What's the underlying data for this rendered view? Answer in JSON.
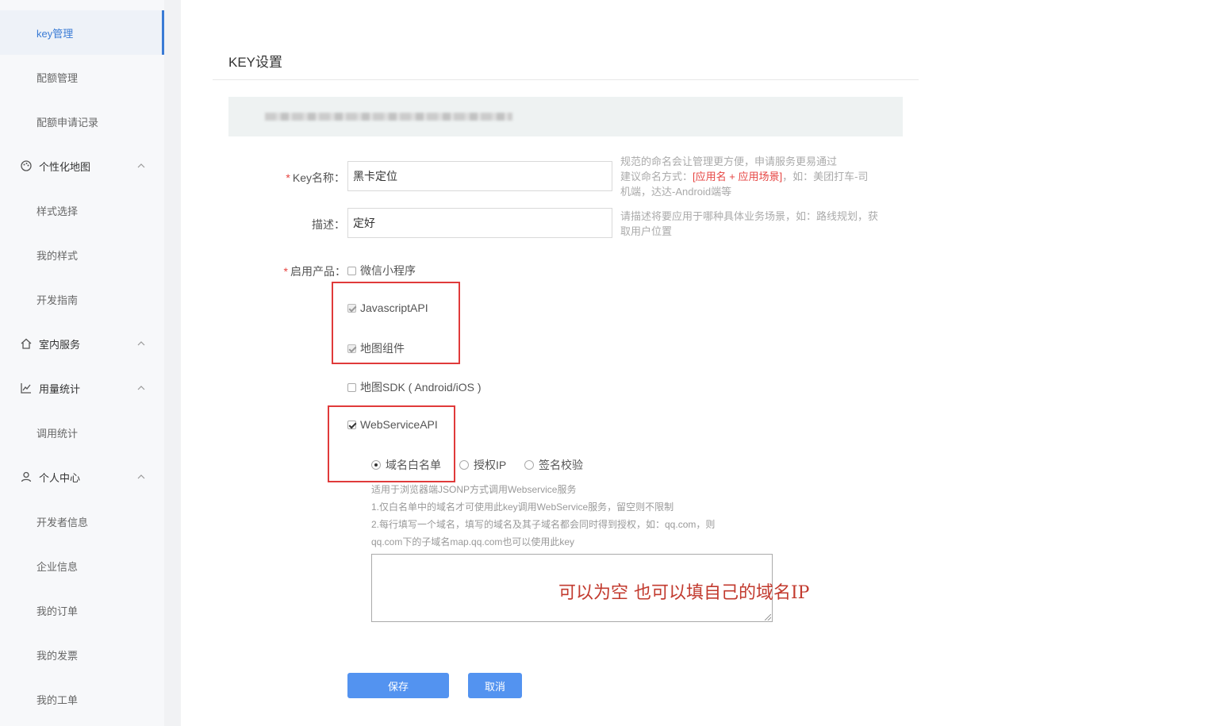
{
  "sidebar": {
    "items": [
      {
        "label": "key管理",
        "active": true
      },
      {
        "label": "配额管理"
      },
      {
        "label": "配额申请记录"
      },
      {
        "label": "个性化地图",
        "icon": "palette-icon",
        "group": true
      },
      {
        "label": "样式选择"
      },
      {
        "label": "我的样式"
      },
      {
        "label": "开发指南"
      },
      {
        "label": "室内服务",
        "icon": "home-icon",
        "group": true
      },
      {
        "label": "用量统计",
        "icon": "line-chart-icon",
        "group": true
      },
      {
        "label": "调用统计"
      },
      {
        "label": "个人中心",
        "icon": "user-icon",
        "group": true
      },
      {
        "label": "开发者信息"
      },
      {
        "label": "企业信息"
      },
      {
        "label": "我的订单"
      },
      {
        "label": "我的发票"
      },
      {
        "label": "我的工单"
      }
    ],
    "accent_color": "#3a7bd5"
  },
  "main": {
    "page_title": "KEY设置",
    "key_name": {
      "required_mark": "*",
      "label": "Key名称：",
      "value": "黑卡定位",
      "hint_line1": "规范的命名会让管理更方便，申请服务更易通过",
      "hint_line2_prefix": "建议命名方式：",
      "hint_line2_emphasis": "[应用名 + 应用场景]",
      "hint_line2_suffix": "，如：美团打车-司",
      "hint_line3": "机端，达达-Android端等"
    },
    "description": {
      "label": "描述：",
      "value": "定好",
      "hint_line1": "请描述将要应用于哪种具体业务场景，如：路线规划，获",
      "hint_line2": "取用户位置"
    },
    "products": {
      "required_mark": "*",
      "label": "启用产品：",
      "options": [
        {
          "label": "微信小程序",
          "checked": false,
          "disabled": false
        },
        {
          "label": "JavascriptAPI",
          "checked": true,
          "disabled": true
        },
        {
          "label": "地图组件",
          "checked": true,
          "disabled": true
        },
        {
          "label": "地图SDK ( Android/iOS )",
          "checked": false,
          "disabled": false
        },
        {
          "label": "WebServiceAPI",
          "checked": true,
          "disabled": false
        }
      ]
    },
    "webservice": {
      "auth_modes": [
        {
          "label": "域名白名单",
          "selected": true
        },
        {
          "label": "授权IP",
          "selected": false
        },
        {
          "label": "签名校验",
          "selected": false
        }
      ],
      "desc_lines": [
        "适用于浏览器端JSONP方式调用Webservice服务",
        "1.仅白名单中的域名才可使用此key调用WebService服务，留空则不限制",
        "2.每行填写一个域名，填写的域名及其子域名都会同时得到授权，如：qq.com，则",
        "qq.com下的子域名map.qq.com也可以使用此key"
      ],
      "whitelist_value": ""
    },
    "annotation": "可以为空  也可以填自己的域名IP",
    "buttons": {
      "save": "保存",
      "cancel": "取消"
    },
    "colors": {
      "primary_button": "#5393f0",
      "required": "#e64340",
      "annotation_box": "#e03a3a"
    }
  }
}
